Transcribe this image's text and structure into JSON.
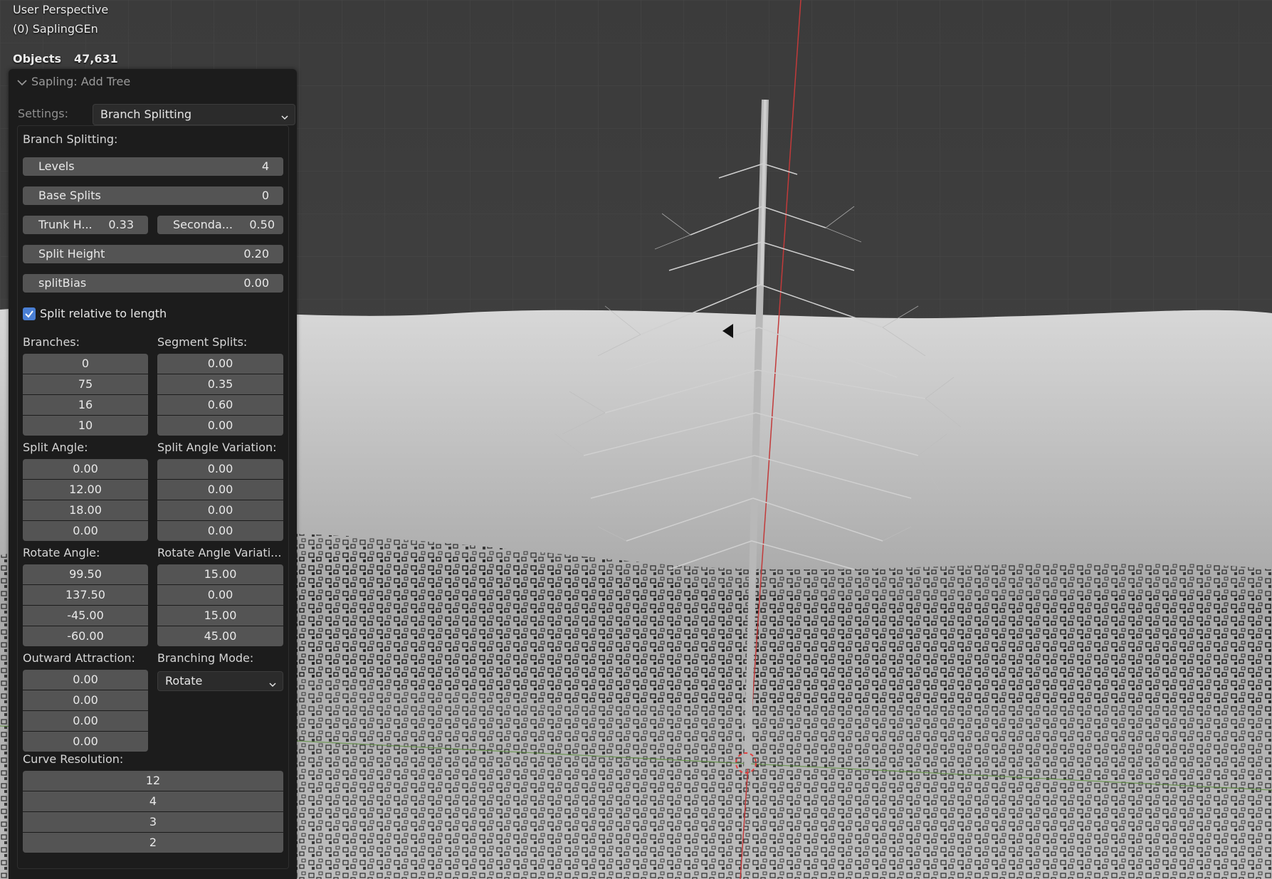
{
  "viewport": {
    "title": "User Perspective",
    "subtitle": "(0) SaplingGEn",
    "stats_label": "Objects",
    "stats_value": "47,631"
  },
  "panel": {
    "title": "Sapling: Add Tree",
    "settings_label": "Settings:",
    "settings_value": "Branch Splitting",
    "section_title": "Branch Splitting:",
    "levels": {
      "label": "Levels",
      "value": "4"
    },
    "base_splits": {
      "label": "Base Splits",
      "value": "0"
    },
    "trunk_height": {
      "label": "Trunk H...",
      "value": "0.33"
    },
    "secondary": {
      "label": "Seconda...",
      "value": "0.50"
    },
    "split_height": {
      "label": "Split Height",
      "value": "0.20"
    },
    "split_bias": {
      "label": "splitBias",
      "value": "0.00"
    },
    "split_relative": {
      "label": "Split relative to length",
      "checked": true
    },
    "branches": {
      "label": "Branches:",
      "values": [
        "0",
        "75",
        "16",
        "10"
      ]
    },
    "segment_splits": {
      "label": "Segment Splits:",
      "values": [
        "0.00",
        "0.35",
        "0.60",
        "0.00"
      ]
    },
    "split_angle": {
      "label": "Split Angle:",
      "values": [
        "0.00",
        "12.00",
        "18.00",
        "0.00"
      ]
    },
    "split_angle_variation": {
      "label": "Split Angle Variation:",
      "values": [
        "0.00",
        "0.00",
        "0.00",
        "0.00"
      ]
    },
    "rotate_angle": {
      "label": "Rotate Angle:",
      "values": [
        "99.50",
        "137.50",
        "-45.00",
        "-60.00"
      ]
    },
    "rotate_angle_variation": {
      "label": "Rotate Angle Variati...",
      "values": [
        "15.00",
        "0.00",
        "15.00",
        "45.00"
      ]
    },
    "outward_attraction": {
      "label": "Outward Attraction:",
      "values": [
        "0.00",
        "0.00",
        "0.00",
        "0.00"
      ]
    },
    "branching_mode": {
      "label": "Branching Mode:",
      "value": "Rotate"
    },
    "curve_resolution": {
      "label": "Curve Resolution:",
      "values": [
        "12",
        "4",
        "3",
        "2"
      ]
    }
  },
  "colors": {
    "panel_bg": "#1c1c1c",
    "field_bg": "#545454",
    "checkbox_accent": "#4a7fd4",
    "x_axis": "#c23a3a",
    "y_axis": "#5a8f3a"
  }
}
